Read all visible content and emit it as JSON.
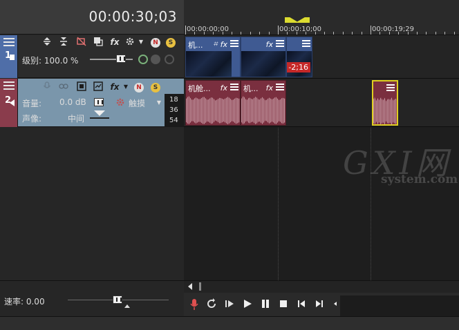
{
  "time_display": "00:00:30;03",
  "ruler": {
    "labels": [
      "00:00:00;00",
      "00:00:10;00",
      "00:00:19;29"
    ]
  },
  "track1": {
    "number": "1",
    "level_label": "级别: 100.0 %",
    "clips": [
      {
        "title": "机..."
      },
      {
        "title": ""
      },
      {
        "title": "",
        "badge": "-2;16"
      }
    ]
  },
  "track2": {
    "number": "2",
    "volume_label": "音量:",
    "volume_value": "0.0 dB",
    "pan_label": "声像:",
    "pan_value": "中间",
    "mode_label": "触摸",
    "db_scale": [
      "18",
      "36",
      "54"
    ],
    "clips": [
      {
        "title": "机舱..."
      },
      {
        "title": "机..."
      }
    ]
  },
  "watermark": {
    "main": "GXI网",
    "sub": "system.com"
  },
  "bottom": {
    "rate_label": "速率: 0.00"
  },
  "colors": {
    "video_track": "#4f6ea8",
    "audio_track": "#8a3c4c",
    "selection": "#e0d020",
    "badge": "#c62828"
  }
}
